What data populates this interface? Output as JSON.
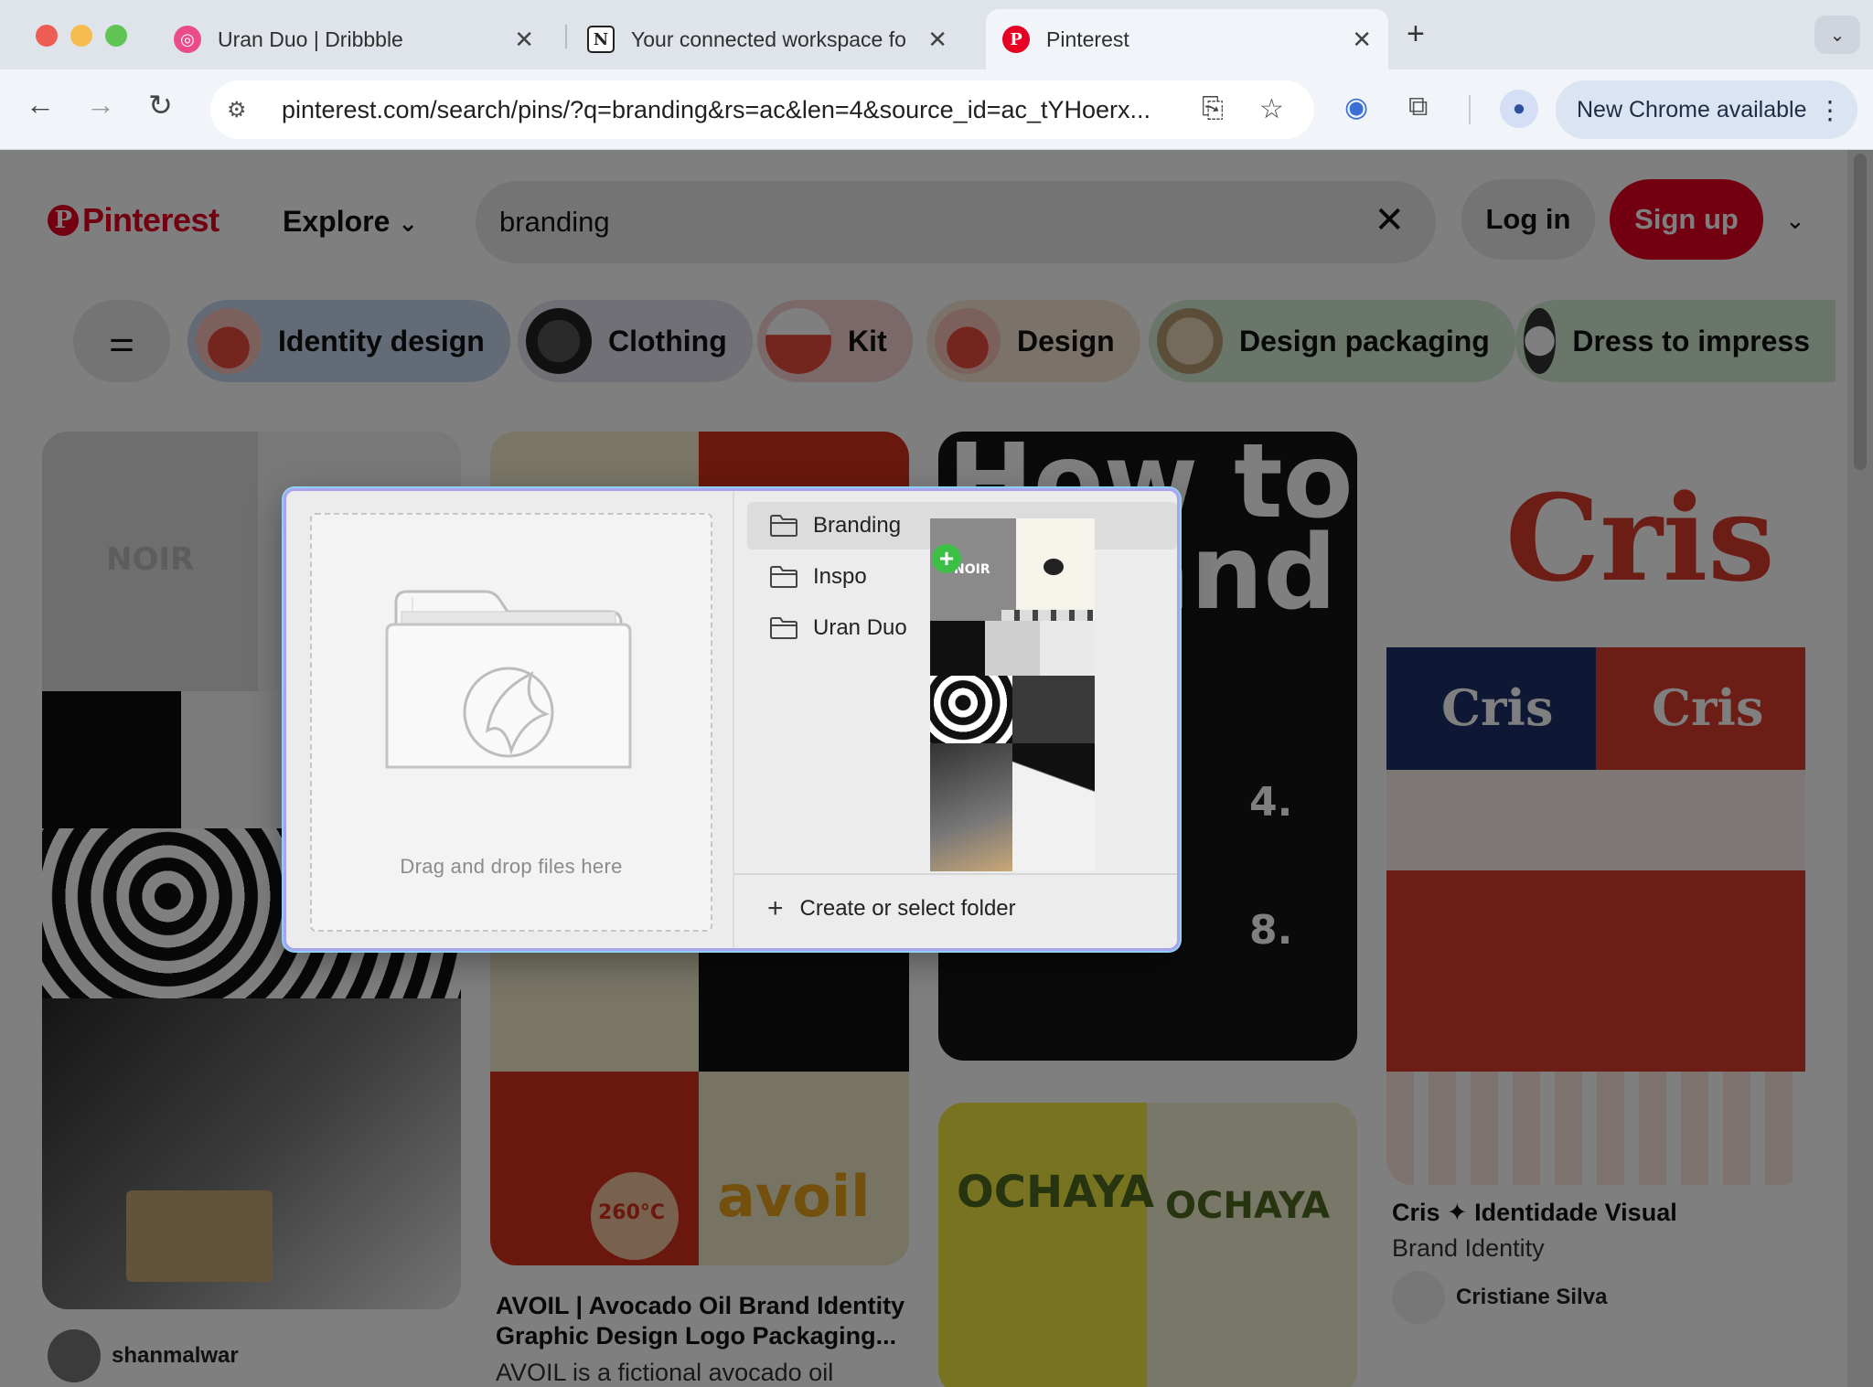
{
  "browser": {
    "tabs": [
      {
        "title": "Uran Duo | Dribbble",
        "favicon": "dribbble-icon",
        "active": false
      },
      {
        "title": "Your connected workspace fo",
        "favicon": "notion-icon",
        "active": false
      },
      {
        "title": "Pinterest",
        "favicon": "pinterest-icon",
        "active": true
      }
    ],
    "url": "pinterest.com/search/pins/?q=branding&rs=ac&len=4&source_id=ac_tYHoerx...",
    "update_label": "New Chrome available"
  },
  "pinterest": {
    "logo_text": "Pinterest",
    "explore_label": "Explore",
    "search_value": "branding",
    "login_label": "Log in",
    "signup_label": "Sign up",
    "chips": [
      {
        "label": "Identity design",
        "color": "#c6d6ee"
      },
      {
        "label": "Clothing",
        "color": "#e1e0ec"
      },
      {
        "label": "Kit",
        "color": "#f6d3d3"
      },
      {
        "label": "Design",
        "color": "#f6e6d3"
      },
      {
        "label": "Design packaging",
        "color": "#d3ecd3"
      },
      {
        "label": "Dress to impress",
        "color": "#d3ecd3"
      }
    ],
    "pins": [
      {
        "user": "shanmalwar"
      },
      {
        "title": "AVOIL | Avocado Oil Brand Identity Graphic Design Logo Packaging...",
        "subtitle": "AVOIL is a fictional avocado oil"
      },
      {
        "title": "How to Brand",
        "brand_text": "OCHAYA"
      },
      {
        "title": "Cris ✦ Identidade Visual",
        "subtitle": "Brand Identity",
        "user": "Cristiane Silva",
        "brand_text": "Cris"
      }
    ],
    "pin_text": {
      "noir": "NOIR",
      "avoil": "avoil",
      "badge": "260°C",
      "how_to": "How to",
      "and": "and",
      "step4": "4.",
      "step8": "8."
    }
  },
  "overlay": {
    "dropzone_label": "Drag and drop files here",
    "folders": [
      "Branding",
      "Inspo",
      "Uran Duo"
    ],
    "selected_folder": "Branding",
    "create_label": "Create or select folder",
    "accent_color": "#a8a4f0"
  }
}
